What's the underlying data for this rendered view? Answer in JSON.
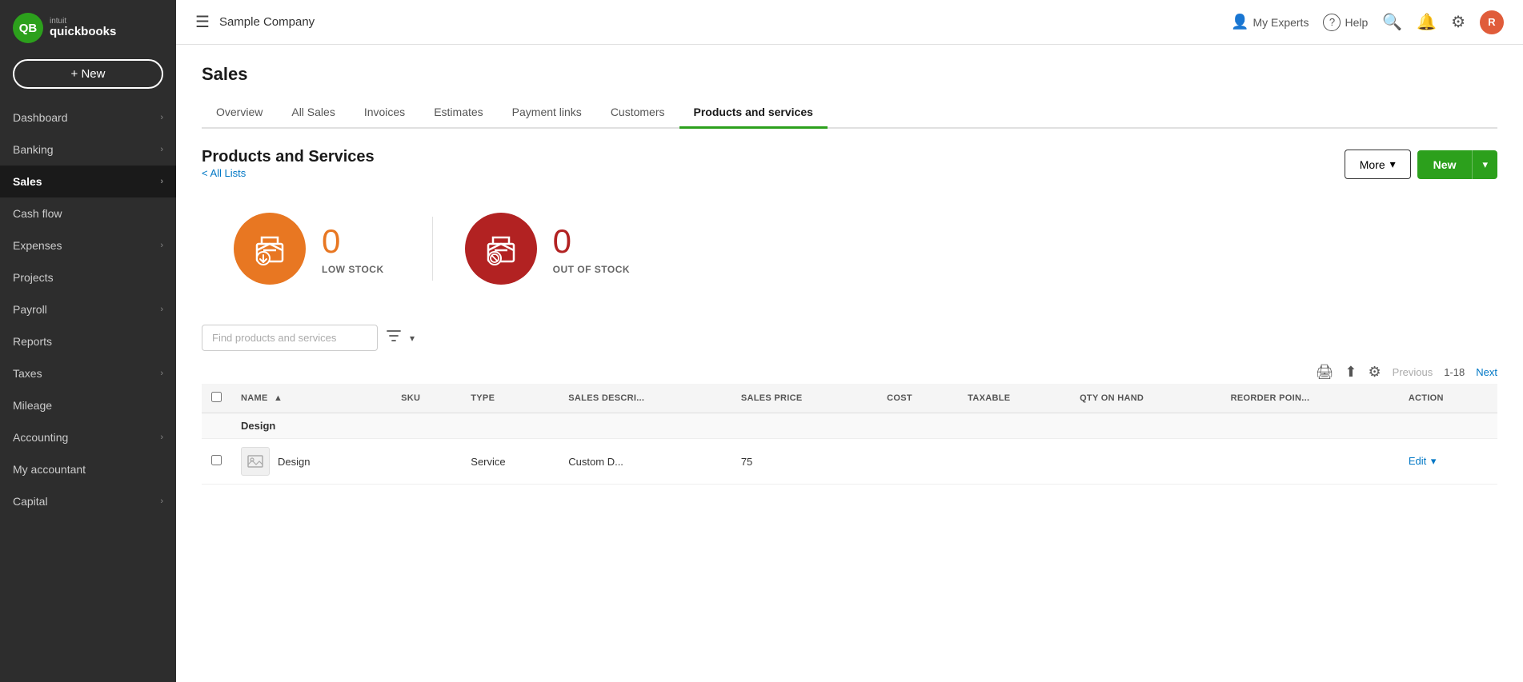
{
  "app": {
    "logo_initial": "QB",
    "logo_brand": "intuit",
    "logo_product": "quickbooks"
  },
  "sidebar": {
    "new_button": "+ New",
    "items": [
      {
        "id": "dashboard",
        "label": "Dashboard",
        "has_arrow": true,
        "active": false
      },
      {
        "id": "banking",
        "label": "Banking",
        "has_arrow": true,
        "active": false
      },
      {
        "id": "sales",
        "label": "Sales",
        "has_arrow": true,
        "active": true
      },
      {
        "id": "cashflow",
        "label": "Cash flow",
        "has_arrow": false,
        "active": false
      },
      {
        "id": "expenses",
        "label": "Expenses",
        "has_arrow": true,
        "active": false
      },
      {
        "id": "projects",
        "label": "Projects",
        "has_arrow": false,
        "active": false
      },
      {
        "id": "payroll",
        "label": "Payroll",
        "has_arrow": true,
        "active": false
      },
      {
        "id": "reports",
        "label": "Reports",
        "has_arrow": false,
        "active": false
      },
      {
        "id": "taxes",
        "label": "Taxes",
        "has_arrow": true,
        "active": false
      },
      {
        "id": "mileage",
        "label": "Mileage",
        "has_arrow": false,
        "active": false
      },
      {
        "id": "accounting",
        "label": "Accounting",
        "has_arrow": true,
        "active": false
      },
      {
        "id": "myaccountant",
        "label": "My accountant",
        "has_arrow": false,
        "active": false
      },
      {
        "id": "capital",
        "label": "Capital",
        "has_arrow": true,
        "active": false
      }
    ]
  },
  "topbar": {
    "company_name": "Sample Company",
    "my_experts_label": "My Experts",
    "help_label": "Help",
    "avatar_initial": "R"
  },
  "page": {
    "title": "Sales",
    "section_title": "Products and Services",
    "all_lists_link": "All Lists",
    "more_button": "More",
    "new_button": "New",
    "tabs": [
      {
        "id": "overview",
        "label": "Overview",
        "active": false
      },
      {
        "id": "allsales",
        "label": "All Sales",
        "active": false
      },
      {
        "id": "invoices",
        "label": "Invoices",
        "active": false
      },
      {
        "id": "estimates",
        "label": "Estimates",
        "active": false
      },
      {
        "id": "paymentlinks",
        "label": "Payment links",
        "active": false
      },
      {
        "id": "customers",
        "label": "Customers",
        "active": false
      },
      {
        "id": "productsservices",
        "label": "Products and services",
        "active": true
      }
    ]
  },
  "stock": {
    "low_stock_count": "0",
    "low_stock_label": "LOW STOCK",
    "out_of_stock_count": "0",
    "out_of_stock_label": "OUT OF STOCK"
  },
  "filter": {
    "search_placeholder": "Find products and services"
  },
  "table": {
    "pagination": {
      "previous": "Previous",
      "range": "1-18",
      "next": "Next"
    },
    "columns": [
      {
        "id": "name",
        "label": "NAME",
        "sortable": true,
        "sort_dir": "asc"
      },
      {
        "id": "sku",
        "label": "SKU",
        "sortable": false
      },
      {
        "id": "type",
        "label": "TYPE",
        "sortable": false
      },
      {
        "id": "sales_desc",
        "label": "SALES DESCRI...",
        "sortable": false
      },
      {
        "id": "sales_price",
        "label": "SALES PRICE",
        "sortable": false
      },
      {
        "id": "cost",
        "label": "COST",
        "sortable": false
      },
      {
        "id": "taxable",
        "label": "TAXABLE",
        "sortable": false
      },
      {
        "id": "qty_on_hand",
        "label": "QTY ON HAND",
        "sortable": false
      },
      {
        "id": "reorder_point",
        "label": "REORDER POIN...",
        "sortable": false
      },
      {
        "id": "action",
        "label": "ACTION",
        "sortable": false
      }
    ],
    "groups": [
      {
        "group_name": "Design",
        "rows": [
          {
            "name": "Design",
            "sku": "",
            "type": "Service",
            "sales_desc": "Custom D...",
            "sales_price": "75",
            "cost": "",
            "taxable": "",
            "qty_on_hand": "",
            "reorder_point": "",
            "action": "Edit",
            "has_image": true
          }
        ]
      }
    ]
  },
  "icons": {
    "hamburger": "☰",
    "chevron_right": "›",
    "chevron_down": "▾",
    "search": "🔍",
    "bell": "🔔",
    "gear": "⚙",
    "person": "👤",
    "question": "?",
    "filter": "⛛",
    "print": "🖨",
    "upload": "⬆",
    "settings_table": "⚙",
    "scroll_up": "∧",
    "sort_asc": "▲",
    "image_placeholder": "🖼"
  },
  "colors": {
    "active_tab_underline": "#2ca01c",
    "new_button_bg": "#2ca01c",
    "sidebar_active_bg": "#1a1a1a",
    "sidebar_bg": "#2d2d2d",
    "low_stock_color": "#e87722",
    "out_of_stock_color": "#b22222",
    "link_color": "#0077c5",
    "avatar_bg": "#e05c3a"
  }
}
